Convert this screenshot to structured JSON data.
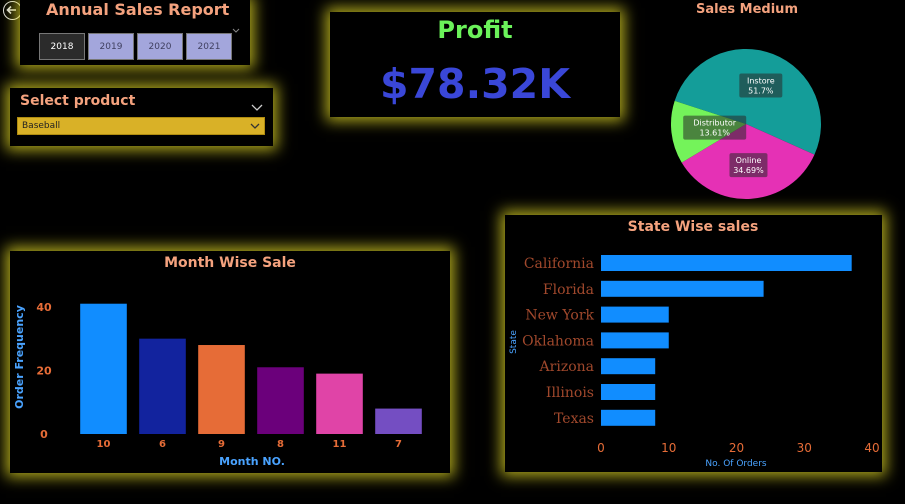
{
  "report": {
    "title": "Annual Sales Report",
    "years": [
      "2018",
      "2019",
      "2020",
      "2021"
    ],
    "selected_year": "2018"
  },
  "product": {
    "label": "Select product",
    "value": "Baseball"
  },
  "kpi": {
    "label": "Profit",
    "value": "$78.32K"
  },
  "colors": {
    "glow": "#ebe128",
    "accent_orange": "#f4a27e",
    "axis_blue": "#4aa3ff",
    "kpi_green": "#6bf25a",
    "kpi_blue": "#3a47d8"
  },
  "chart_data": [
    {
      "type": "pie",
      "title": "Sales Medium",
      "slices": [
        {
          "name": "Instore",
          "value": 51.7,
          "label": "51.7%",
          "color": "#149d99"
        },
        {
          "name": "Online",
          "value": 34.69,
          "label": "34.69%",
          "color": "#e531b5"
        },
        {
          "name": "Distributor",
          "value": 13.61,
          "label": "13.61%",
          "color": "#74f35a"
        }
      ]
    },
    {
      "type": "bar",
      "title": "Month Wise Sale",
      "xlabel": "Month NO.",
      "ylabel": "Order Frequency",
      "categories": [
        "10",
        "6",
        "9",
        "8",
        "11",
        "7"
      ],
      "values": [
        41,
        30,
        28,
        21,
        19,
        8
      ],
      "colors": [
        "#118dff",
        "#12239e",
        "#e66c37",
        "#6b007b",
        "#e044a7",
        "#744ec2"
      ],
      "ylim": [
        0,
        45
      ],
      "yticks": [
        0,
        20,
        40
      ]
    },
    {
      "type": "bar",
      "orientation": "horizontal",
      "title": "State Wise sales",
      "xlabel": "No. Of Orders",
      "ylabel": "State",
      "categories": [
        "California",
        "Florida",
        "New York",
        "Oklahoma",
        "Arizona",
        "Illinois",
        "Texas"
      ],
      "values": [
        37,
        24,
        10,
        10,
        8,
        8,
        8
      ],
      "color": "#118dff",
      "xlim": [
        0,
        40
      ],
      "xticks": [
        0,
        10,
        20,
        30,
        40
      ]
    }
  ]
}
